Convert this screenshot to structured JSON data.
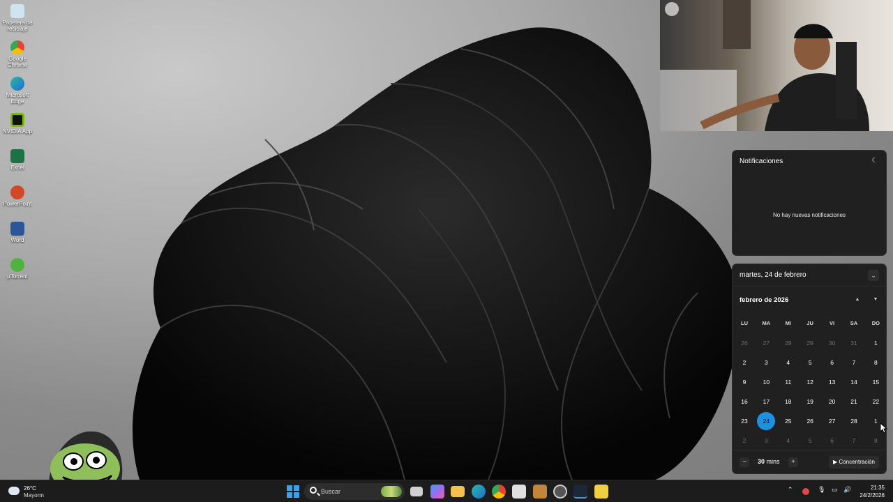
{
  "desktop": {
    "icons": [
      {
        "label": "Papelera de reciclaje",
        "icon": "recycle-bin-icon",
        "color": "#cfe3f0"
      },
      {
        "label": "Google Chrome",
        "icon": "chrome-icon",
        "color": "#e94235"
      },
      {
        "label": "Microsoft Edge",
        "icon": "edge-icon",
        "color": "#2fb6a6"
      },
      {
        "label": "NVIDIA App",
        "icon": "nvidia-icon",
        "color": "#76b900"
      },
      {
        "label": "Excel",
        "icon": "excel-icon",
        "color": "#1e7145"
      },
      {
        "label": "PowerPoint",
        "icon": "powerpoint-icon",
        "color": "#d24726"
      },
      {
        "label": "Word",
        "icon": "word-icon",
        "color": "#2b579a"
      },
      {
        "label": "µTorrent",
        "icon": "utorrent-icon",
        "color": "#51b33f"
      }
    ]
  },
  "notifications": {
    "title": "Notificaciones",
    "empty_text": "No hay nuevas notificaciones",
    "dnd_icon": "do-not-disturb-icon"
  },
  "calendar": {
    "date_header": "martes, 24 de febrero",
    "month_label": "febrero de 2026",
    "weekdays": [
      "LU",
      "MA",
      "MI",
      "JU",
      "VI",
      "SA",
      "DO"
    ],
    "weeks": [
      [
        [
          "26",
          true
        ],
        [
          "27",
          true
        ],
        [
          "28",
          true
        ],
        [
          "29",
          true
        ],
        [
          "30",
          true
        ],
        [
          "31",
          true
        ],
        [
          "1",
          false
        ]
      ],
      [
        [
          "2",
          false
        ],
        [
          "3",
          false
        ],
        [
          "4",
          false
        ],
        [
          "5",
          false
        ],
        [
          "6",
          false
        ],
        [
          "7",
          false
        ],
        [
          "8",
          false
        ]
      ],
      [
        [
          "9",
          false
        ],
        [
          "10",
          false
        ],
        [
          "11",
          false
        ],
        [
          "12",
          false
        ],
        [
          "13",
          false
        ],
        [
          "14",
          false
        ],
        [
          "15",
          false
        ]
      ],
      [
        [
          "16",
          false
        ],
        [
          "17",
          false
        ],
        [
          "18",
          false
        ],
        [
          "19",
          false
        ],
        [
          "20",
          false
        ],
        [
          "21",
          false
        ],
        [
          "22",
          false
        ]
      ],
      [
        [
          "23",
          false
        ],
        [
          "24",
          false
        ],
        [
          "25",
          false
        ],
        [
          "26",
          false
        ],
        [
          "27",
          false
        ],
        [
          "28",
          false
        ],
        [
          "1",
          false
        ]
      ],
      [
        [
          "2",
          true
        ],
        [
          "3",
          true
        ],
        [
          "4",
          true
        ],
        [
          "5",
          true
        ],
        [
          "6",
          true
        ],
        [
          "7",
          true
        ],
        [
          "8",
          true
        ]
      ]
    ],
    "today": "24",
    "accent": "#1e90e0",
    "focus": {
      "minus": "−",
      "plus": "+",
      "value": "30",
      "unit": "mins",
      "button": "Concentración"
    }
  },
  "taskbar": {
    "weather_temp": "26°C",
    "weather_desc": "Mayorm",
    "search_placeholder": "Buscar",
    "apps": [
      {
        "name": "start-icon",
        "color": "#3aa0f0"
      },
      {
        "name": "task-view-icon",
        "color": "#d0d0d0"
      },
      {
        "name": "copilot-icon",
        "color": "#9b6cf0"
      },
      {
        "name": "file-explorer-icon",
        "color": "#f2c14e"
      },
      {
        "name": "edge-icon",
        "color": "#2fa6d8"
      },
      {
        "name": "chrome-icon",
        "color": "#e94235"
      },
      {
        "name": "store-icon",
        "color": "#e0e0e0"
      },
      {
        "name": "game-icon",
        "color": "#c2853b"
      },
      {
        "name": "obs-icon",
        "color": "#8a8a8a"
      },
      {
        "name": "steam-icon",
        "color": "#5a8fd0"
      },
      {
        "name": "app-icon",
        "color": "#f0d040"
      }
    ],
    "time": "21:35",
    "date": "24/2/2026"
  }
}
